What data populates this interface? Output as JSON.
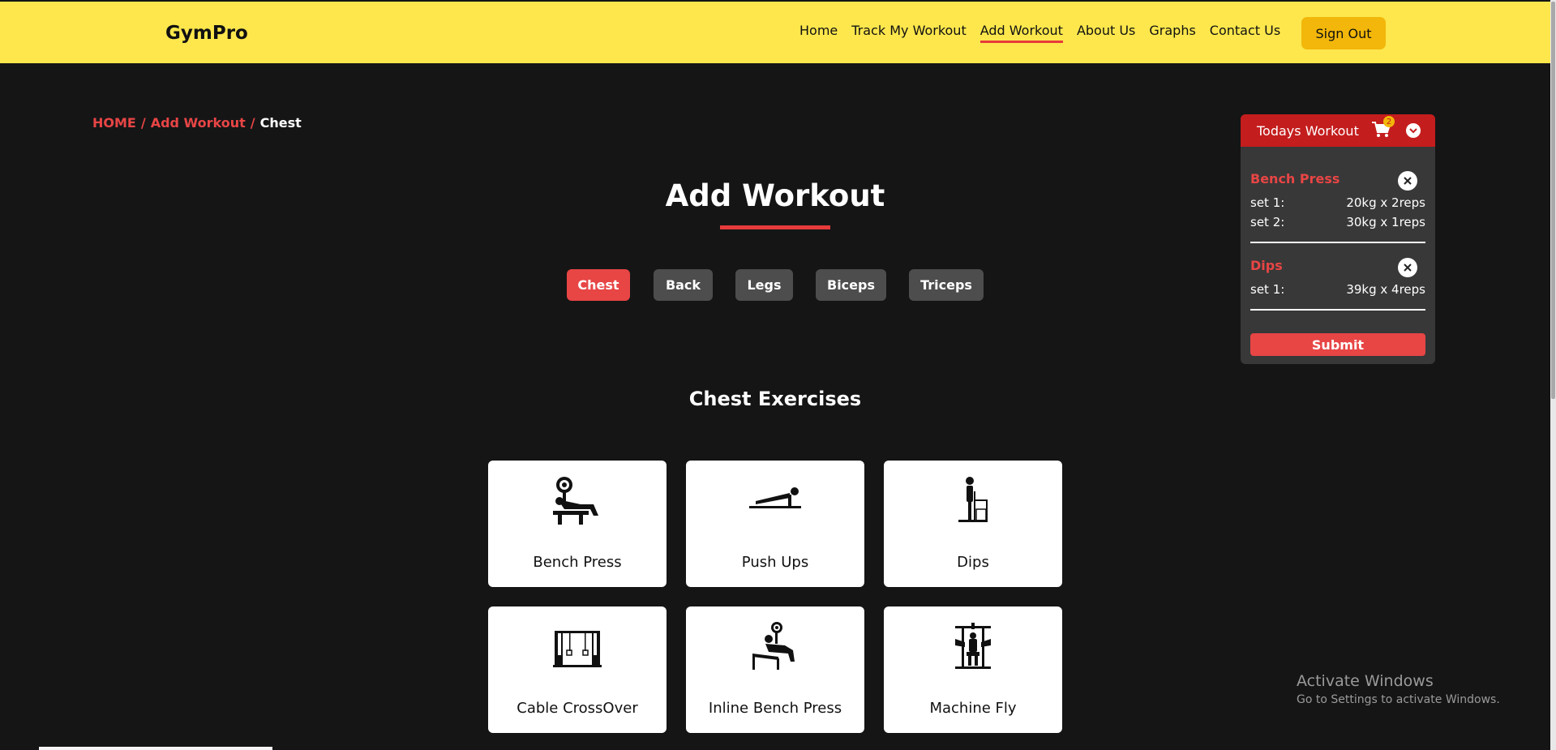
{
  "nav": {
    "brand": "GymPro",
    "links": [
      "Home",
      "Track My Workout",
      "Add Workout",
      "About Us",
      "Graphs",
      "Contact Us"
    ],
    "active_link": "Add Workout",
    "signout_label": "Sign Out"
  },
  "breadcrumb": {
    "home": "HOME",
    "sep": "/",
    "parent": "Add Workout",
    "current": "Chest"
  },
  "page_title": "Add Workout",
  "tabs": [
    "Chest",
    "Back",
    "Legs",
    "Biceps",
    "Triceps"
  ],
  "active_tab": "Chest",
  "section_title": "Chest Exercises",
  "exercises": [
    {
      "label": "Bench Press",
      "icon": "bench-press-icon"
    },
    {
      "label": "Push Ups",
      "icon": "push-up-icon"
    },
    {
      "label": "Dips",
      "icon": "dips-icon"
    },
    {
      "label": "Cable CrossOver",
      "icon": "cable-crossover-icon"
    },
    {
      "label": "Inline Bench Press",
      "icon": "incline-bench-press-icon"
    },
    {
      "label": "Machine Fly",
      "icon": "machine-fly-icon"
    }
  ],
  "panel": {
    "title": "Todays Workout",
    "cart_count": "2",
    "items": [
      {
        "name": "Bench Press",
        "sets": [
          {
            "label": "set 1:",
            "value": "20kg x 2reps"
          },
          {
            "label": "set 2:",
            "value": "30kg x 1reps"
          }
        ]
      },
      {
        "name": "Dips",
        "sets": [
          {
            "label": "set 1:",
            "value": "39kg x 4reps"
          }
        ]
      }
    ],
    "submit_label": "Submit"
  },
  "watermark": {
    "title": "Activate Windows",
    "subtitle": "Go to Settings to activate Windows."
  },
  "colors": {
    "navbar": "#fde74c",
    "accent": "#e84545",
    "signout": "#f2b70a",
    "background": "#151516"
  }
}
